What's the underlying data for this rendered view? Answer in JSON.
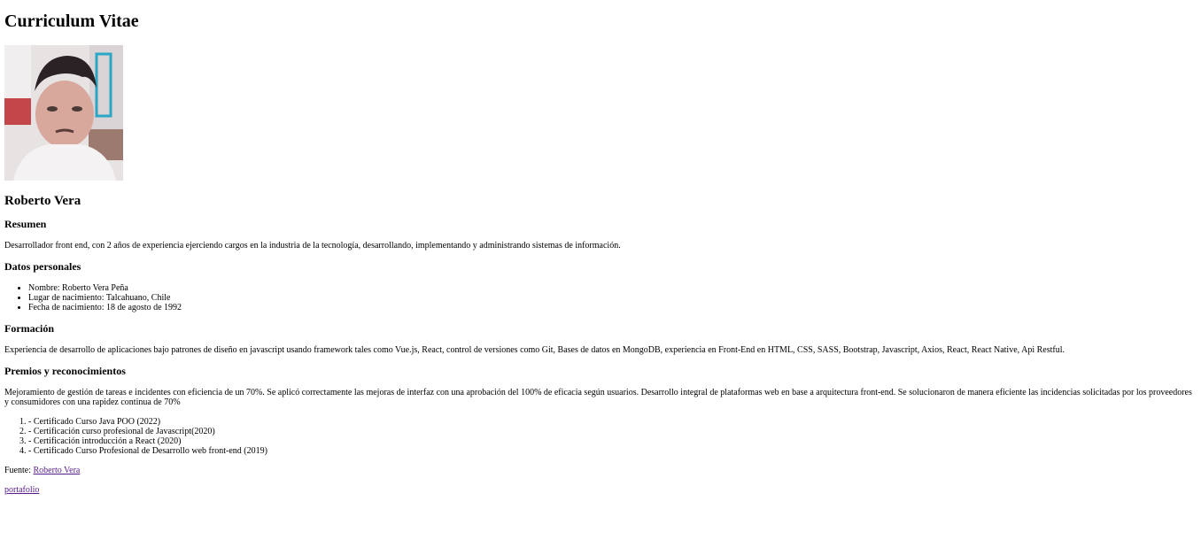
{
  "page": {
    "title": "Curriculum Vitae",
    "photo_alt": "Roberto Vera",
    "name": "Roberto Vera"
  },
  "resumen": {
    "heading": "Resumen",
    "text": "Desarrollador front end, con 2 años de experiencia ejerciendo cargos en la industria de la tecnología, desarrollando, implementando y administrando sistemas de información."
  },
  "datos_personales": {
    "heading": "Datos personales",
    "items": [
      "Nombre: Roberto Vera Peña",
      "Lugar de nacimiento: Talcahuano, Chile",
      "Fecha de nacimiento: 18 de agosto de 1992"
    ]
  },
  "formacion": {
    "heading": "Formación",
    "text": "Experiencia de desarrollo de aplicaciones bajo patrones de diseño en javascript usando framework tales como Vue.js, React, control de versiones como Git, Bases de datos en MongoDB, experiencia en Front-End en HTML, CSS, SASS, Bootstrap, Javascript, Axios, React, React Native, Api Restful."
  },
  "premios": {
    "heading": "Premios y reconocimientos",
    "text": "Mejoramiento de gestión de tareas e incidentes con eficiencia de un 70%. Se aplicó correctamente las mejoras de interfaz con una aprobación del 100% de eficacia según usuarios. Desarrollo integral de plataformas web en base a arquitectura front-end. Se solucionaron de manera eficiente las incidencias solicitadas por los proveedores y consumidores con una rapidez continua de 70%",
    "items": [
      "- Certificado Curso Java POO (2022)",
      "- Certificación curso profesional de Javascript(2020)",
      "- Certificación introducción a React (2020)",
      "- Certificado Curso Profesional de Desarrollo web front-end (2019)"
    ]
  },
  "footer": {
    "fuente_label": "Fuente: ",
    "fuente_link": "Roberto Vera",
    "portafolio_link": "portafolio"
  },
  "colors": {
    "link_visited": "#551a8b",
    "text": "#000000",
    "background": "#ffffff"
  }
}
